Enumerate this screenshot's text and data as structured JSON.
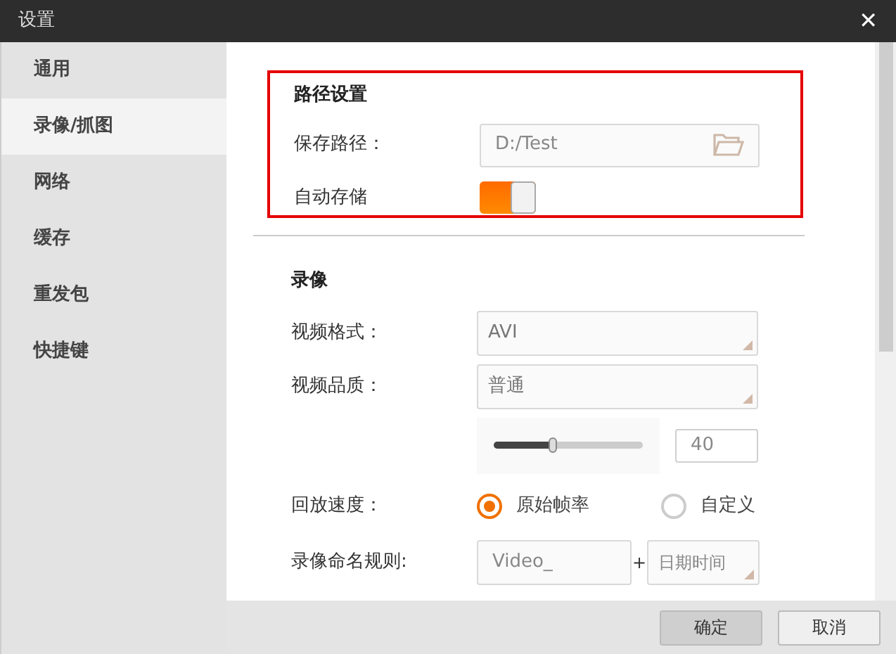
{
  "window": {
    "title": "设置",
    "close": "✕"
  },
  "sidebar": {
    "items": [
      {
        "label": "通用",
        "selected": false
      },
      {
        "label": "录像/抓图",
        "selected": true
      },
      {
        "label": "网络",
        "selected": false
      },
      {
        "label": "缓存",
        "selected": false
      },
      {
        "label": "重发包",
        "selected": false
      },
      {
        "label": "快捷键",
        "selected": false
      }
    ]
  },
  "path_section": {
    "title": "路径设置",
    "highlighted": true,
    "save_path": {
      "label": "保存路径：",
      "value": "D:/Test"
    },
    "auto_save": {
      "label": "自动存储",
      "on": true
    }
  },
  "record_section": {
    "title": "录像",
    "video_format": {
      "label": "视频格式：",
      "value": "AVI"
    },
    "video_quality": {
      "label": "视频品质：",
      "value": "普通",
      "level": 0.4,
      "reading": "40"
    },
    "playback_speed": {
      "label": "回放速度：",
      "options": [
        {
          "label": "原始帧率",
          "selected": true
        },
        {
          "label": "自定义",
          "selected": false
        }
      ]
    },
    "naming_rule": {
      "label": "录像命名规则:",
      "prefix": "Video_",
      "plus": "+",
      "suffix": "日期时间"
    }
  },
  "buttons": [
    {
      "label": "确定",
      "kind": "primary"
    },
    {
      "label": "取消",
      "kind": "secondary"
    }
  ]
}
